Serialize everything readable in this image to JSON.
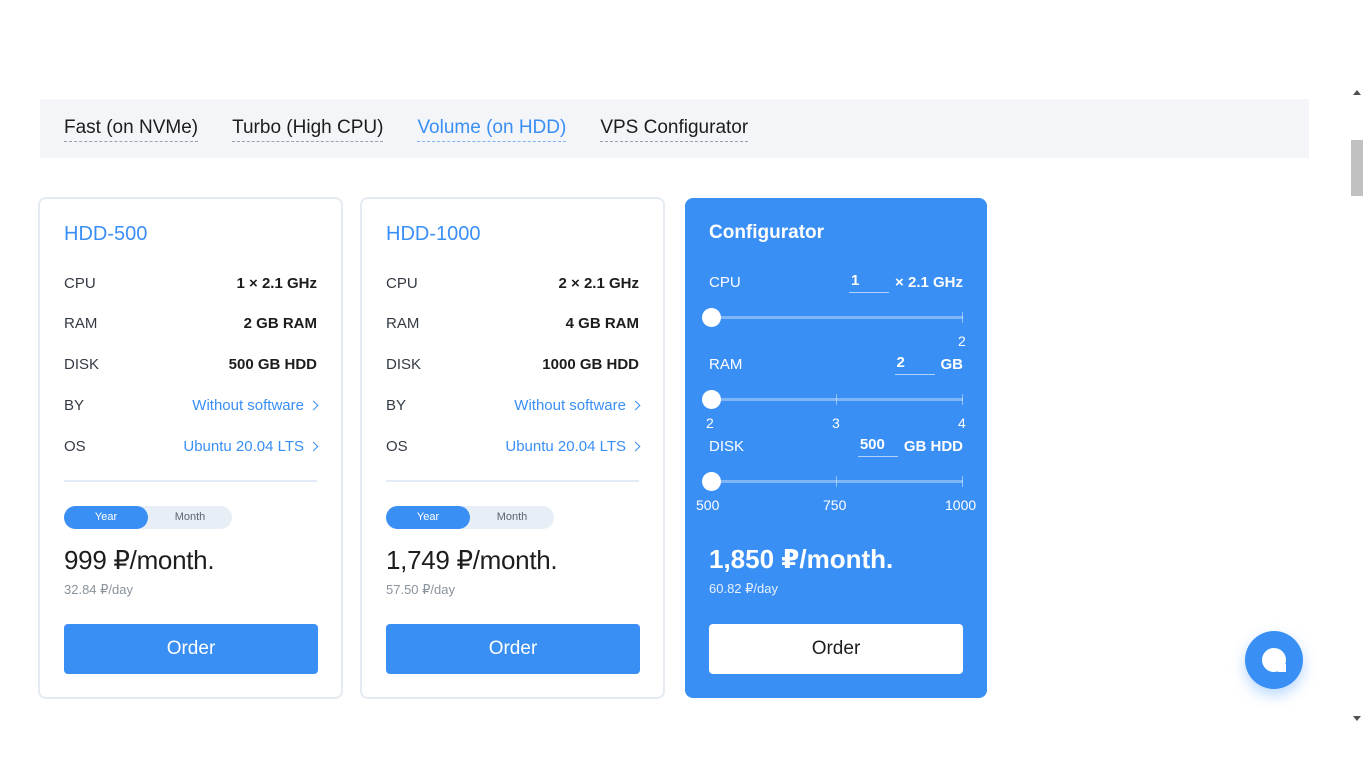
{
  "tabs": [
    {
      "label": "Fast (on NVMe)",
      "active": false
    },
    {
      "label": "Turbo (High CPU)",
      "active": false
    },
    {
      "label": "Volume (on HDD)",
      "active": true
    },
    {
      "label": "VPS Configurator",
      "active": false
    }
  ],
  "plans": [
    {
      "title": "HDD-500",
      "specs": [
        {
          "label": "CPU",
          "value": "1 × 2.1 GHz"
        },
        {
          "label": "RAM",
          "value": "2 GB RAM"
        },
        {
          "label": "DISK",
          "value": "500 GB HDD"
        },
        {
          "label": "BY",
          "value": "Without software"
        },
        {
          "label": "OS",
          "value": "Ubuntu 20.04 LTS"
        }
      ],
      "toggle": {
        "year": "Year",
        "month": "Month",
        "selected": "Year"
      },
      "price": "999 ₽/month.",
      "per_day": "32.84 ₽/day",
      "order": "Order"
    },
    {
      "title": "HDD-1000",
      "specs": [
        {
          "label": "CPU",
          "value": "2 × 2.1 GHz"
        },
        {
          "label": "RAM",
          "value": "4 GB RAM"
        },
        {
          "label": "DISK",
          "value": "1000 GB HDD"
        },
        {
          "label": "BY",
          "value": "Without software"
        },
        {
          "label": "OS",
          "value": "Ubuntu 20.04 LTS"
        }
      ],
      "toggle": {
        "year": "Year",
        "month": "Month",
        "selected": "Year"
      },
      "price": "1,749 ₽/month.",
      "per_day": "57.50 ₽/day",
      "order": "Order"
    }
  ],
  "configurator": {
    "title": "Configurator",
    "cpu": {
      "label": "CPU",
      "value": "1",
      "unit": "× 2.1 GHz",
      "min": 1,
      "max": 2,
      "current": 1,
      "ticks": [
        "2"
      ]
    },
    "ram": {
      "label": "RAM",
      "value": "2",
      "unit": "GB",
      "min": 2,
      "max": 4,
      "current": 2,
      "ticks": [
        "2",
        "3",
        "4"
      ]
    },
    "disk": {
      "label": "DISK",
      "value": "500",
      "unit": "GB HDD",
      "min": 500,
      "max": 1000,
      "current": 500,
      "ticks": [
        "500",
        "750",
        "1000"
      ]
    },
    "price": "1,850 ₽/month.",
    "per_day": "60.82 ₽/day",
    "order": "Order"
  },
  "colors": {
    "accent": "#3a8ff5",
    "tab_bg": "#f3f5f8",
    "card_border": "#e6ebf1"
  },
  "icons": {
    "chevron": "chevron-right-icon",
    "chat": "chat-bubble-icon"
  }
}
